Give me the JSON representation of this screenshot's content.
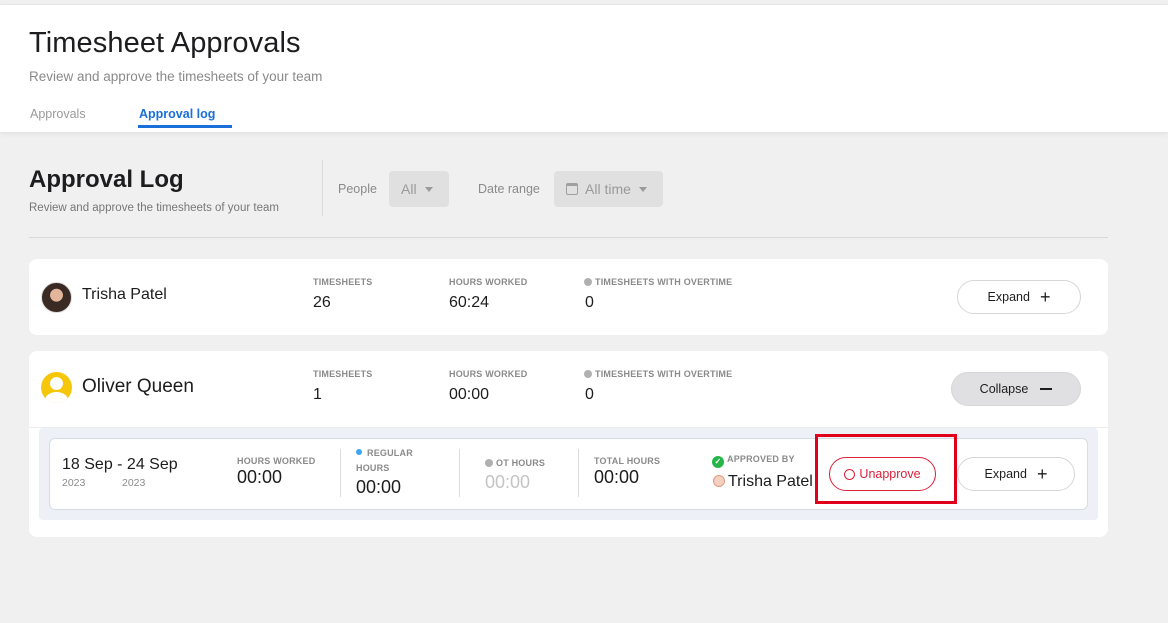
{
  "header": {
    "title": "Timesheet Approvals",
    "subtitle": "Review and approve the timesheets of your team",
    "tabs": [
      {
        "label": "Approvals",
        "active": false
      },
      {
        "label": "Approval log",
        "active": true
      }
    ]
  },
  "section": {
    "title": "Approval Log",
    "subtitle": "Review and approve the timesheets of your team",
    "filters": {
      "people_label": "People",
      "people_value": "All",
      "date_label": "Date range",
      "date_value": "All time"
    }
  },
  "people": [
    {
      "name": "Trisha Patel",
      "stats": [
        {
          "label": "Timesheets",
          "value": "26"
        },
        {
          "label": "Hours worked",
          "value": "60:24"
        },
        {
          "label": "Timesheets with overtime",
          "value": "0"
        }
      ],
      "toggle_label": "Expand"
    },
    {
      "name": "Oliver Queen",
      "stats": [
        {
          "label": "Timesheets",
          "value": "1"
        },
        {
          "label": "Hours worked",
          "value": "00:00"
        },
        {
          "label": "Timesheets with overtime",
          "value": "0"
        }
      ],
      "toggle_label": "Collapse",
      "timesheets": [
        {
          "range": "18 Sep - 24 Sep",
          "year_start": "2023",
          "year_end": "2023",
          "hours_worked_label": "Hours worked",
          "hours_worked": "00:00",
          "regular_label_1": "Regular",
          "regular_label_2": "hours",
          "regular_hours": "00:00",
          "ot_label": "OT hours",
          "ot_hours": "00:00",
          "total_label": "Total hours",
          "total_hours": "00:00",
          "approved_by_label": "Approved by",
          "approved_by": "Trisha Patel",
          "unapprove_label": "Unapprove",
          "expand_label": "Expand"
        }
      ]
    }
  ],
  "colors": {
    "accent": "#1a6fd8",
    "danger": "#d9213a",
    "success": "#27b54a",
    "highlight": "#e0001b"
  }
}
